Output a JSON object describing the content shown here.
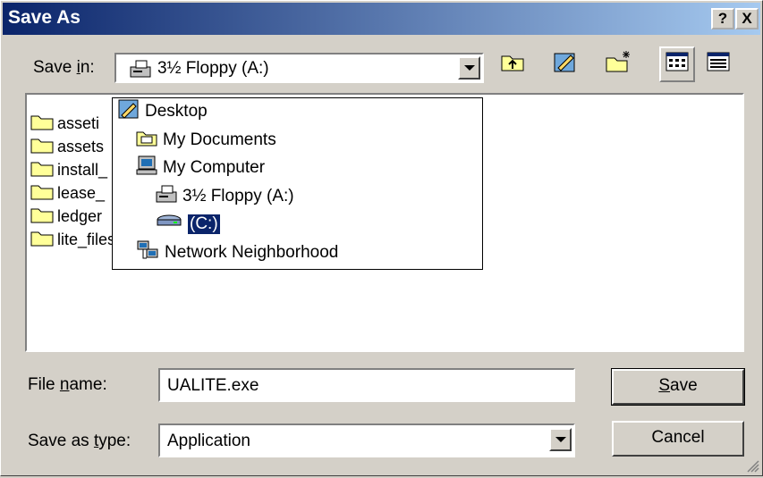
{
  "window": {
    "title": "Save As",
    "help_label": "?",
    "close_label": "X"
  },
  "save_in": {
    "label_pre": "Save ",
    "label_key": "i",
    "label_post": "n:",
    "value": "3½ Floppy (A:)"
  },
  "toolbar": {
    "icons": [
      "up-folder-icon",
      "desktop-icon",
      "new-folder-icon",
      "list-view-icon",
      "details-view-icon"
    ]
  },
  "dropdown_items": [
    {
      "label": "Desktop",
      "icon": "desktop-icon"
    },
    {
      "label": "My Documents",
      "icon": "folder-icon"
    },
    {
      "label": "My Computer",
      "icon": "computer-icon"
    },
    {
      "label": "3½ Floppy (A:)",
      "icon": "floppy-drive-icon"
    },
    {
      "label": "(C:)",
      "icon": "hard-drive-icon",
      "selected": true
    },
    {
      "label": "Network Neighborhood",
      "icon": "network-icon"
    }
  ],
  "files": [
    "asseti",
    "assets",
    "install_",
    "lease_",
    "ledger",
    "lite_files"
  ],
  "filename": {
    "label_pre": "File ",
    "label_key": "n",
    "label_post": "ame:",
    "value": "UALITE.exe"
  },
  "filetype": {
    "label_pre": "Save as ",
    "label_key": "t",
    "label_post": "ype:",
    "value": "Application"
  },
  "buttons": {
    "save_key": "S",
    "save_rest": "ave",
    "cancel": "Cancel"
  },
  "colors": {
    "title_start": "#0a246a",
    "title_end": "#a6caf0",
    "face": "#d4d0c8",
    "selection": "#0a246a"
  }
}
